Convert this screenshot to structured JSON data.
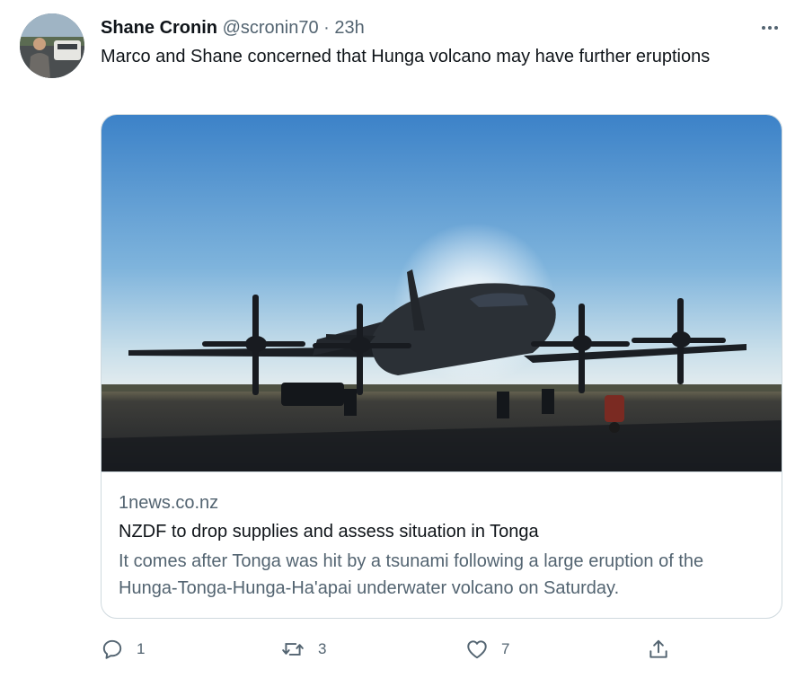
{
  "author": {
    "display_name": "Shane Cronin",
    "handle": "@scronin70",
    "separator": "·",
    "time": "23h"
  },
  "tweet": {
    "text": "Marco and Shane concerned that Hunga volcano may have further eruptions"
  },
  "card": {
    "domain": "1news.co.nz",
    "title": "NZDF to drop supplies and assess situation in Tonga",
    "description": "It comes after Tonga was hit by a tsunami following a large eruption of the Hunga-Tonga-Hunga-Ha'apai underwater volcano on Saturday."
  },
  "actions": {
    "reply_count": "1",
    "retweet_count": "3",
    "like_count": "7"
  },
  "icons": {
    "more": "more-icon",
    "reply": "reply-icon",
    "retweet": "retweet-icon",
    "like": "heart-icon",
    "share": "share-icon"
  },
  "colors": {
    "text_primary": "#0f1419",
    "text_secondary": "#536471",
    "border": "#cfd9de"
  }
}
